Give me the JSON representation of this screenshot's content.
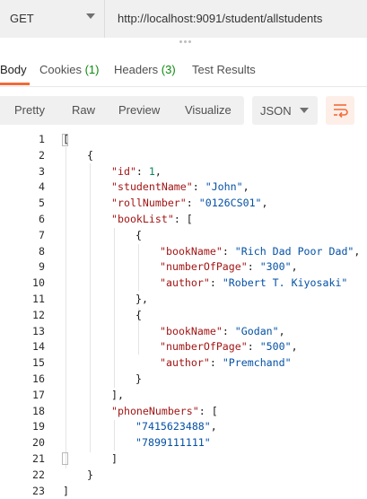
{
  "request": {
    "method": "GET",
    "url": "http://localhost:9091/student/allstudents"
  },
  "response_tabs": [
    {
      "label": "Body",
      "count": ""
    },
    {
      "label": "Cookies",
      "count": "(1)"
    },
    {
      "label": "Headers",
      "count": "(3)"
    },
    {
      "label": "Test Results",
      "count": ""
    }
  ],
  "view_modes": [
    "Pretty",
    "Raw",
    "Preview",
    "Visualize"
  ],
  "format": "JSON",
  "icons": {
    "method_dropdown": "chevron-down-icon",
    "format_dropdown": "chevron-down-icon",
    "wrap": "wrap-lines-icon"
  },
  "colors": {
    "accent": "#f26b3a",
    "count": "#0e8a0e",
    "json_key": "#a31515",
    "json_string": "#0451a5",
    "json_number": "#098658"
  },
  "code_lines": [
    {
      "n": "1",
      "indent": 0,
      "parts": [
        {
          "t": "[",
          "c": "p"
        }
      ]
    },
    {
      "n": "2",
      "indent": 1,
      "parts": [
        {
          "t": "{",
          "c": "p"
        }
      ]
    },
    {
      "n": "3",
      "indent": 2,
      "parts": [
        {
          "t": "\"id\"",
          "c": "k"
        },
        {
          "t": ": ",
          "c": "p"
        },
        {
          "t": "1",
          "c": "n"
        },
        {
          "t": ",",
          "c": "p"
        }
      ]
    },
    {
      "n": "4",
      "indent": 2,
      "parts": [
        {
          "t": "\"studentName\"",
          "c": "k"
        },
        {
          "t": ": ",
          "c": "p"
        },
        {
          "t": "\"John\"",
          "c": "s"
        },
        {
          "t": ",",
          "c": "p"
        }
      ]
    },
    {
      "n": "5",
      "indent": 2,
      "parts": [
        {
          "t": "\"rollNumber\"",
          "c": "k"
        },
        {
          "t": ": ",
          "c": "p"
        },
        {
          "t": "\"0126CS01\"",
          "c": "s"
        },
        {
          "t": ",",
          "c": "p"
        }
      ]
    },
    {
      "n": "6",
      "indent": 2,
      "parts": [
        {
          "t": "\"bookList\"",
          "c": "k"
        },
        {
          "t": ": [",
          "c": "p"
        }
      ]
    },
    {
      "n": "7",
      "indent": 3,
      "parts": [
        {
          "t": "{",
          "c": "p"
        }
      ]
    },
    {
      "n": "8",
      "indent": 4,
      "parts": [
        {
          "t": "\"bookName\"",
          "c": "k"
        },
        {
          "t": ": ",
          "c": "p"
        },
        {
          "t": "\"Rich Dad Poor Dad\"",
          "c": "s"
        },
        {
          "t": ",",
          "c": "p"
        }
      ]
    },
    {
      "n": "9",
      "indent": 4,
      "parts": [
        {
          "t": "\"numberOfPage\"",
          "c": "k"
        },
        {
          "t": ": ",
          "c": "p"
        },
        {
          "t": "\"300\"",
          "c": "s"
        },
        {
          "t": ",",
          "c": "p"
        }
      ]
    },
    {
      "n": "10",
      "indent": 4,
      "parts": [
        {
          "t": "\"author\"",
          "c": "k"
        },
        {
          "t": ": ",
          "c": "p"
        },
        {
          "t": "\"Robert T. Kiyosaki\"",
          "c": "s"
        }
      ]
    },
    {
      "n": "11",
      "indent": 3,
      "parts": [
        {
          "t": "},",
          "c": "p"
        }
      ]
    },
    {
      "n": "12",
      "indent": 3,
      "parts": [
        {
          "t": "{",
          "c": "p"
        }
      ]
    },
    {
      "n": "13",
      "indent": 4,
      "parts": [
        {
          "t": "\"bookName\"",
          "c": "k"
        },
        {
          "t": ": ",
          "c": "p"
        },
        {
          "t": "\"Godan\"",
          "c": "s"
        },
        {
          "t": ",",
          "c": "p"
        }
      ]
    },
    {
      "n": "14",
      "indent": 4,
      "parts": [
        {
          "t": "\"numberOfPage\"",
          "c": "k"
        },
        {
          "t": ": ",
          "c": "p"
        },
        {
          "t": "\"500\"",
          "c": "s"
        },
        {
          "t": ",",
          "c": "p"
        }
      ]
    },
    {
      "n": "15",
      "indent": 4,
      "parts": [
        {
          "t": "\"author\"",
          "c": "k"
        },
        {
          "t": ": ",
          "c": "p"
        },
        {
          "t": "\"Premchand\"",
          "c": "s"
        }
      ]
    },
    {
      "n": "16",
      "indent": 3,
      "parts": [
        {
          "t": "}",
          "c": "p"
        }
      ]
    },
    {
      "n": "17",
      "indent": 2,
      "parts": [
        {
          "t": "],",
          "c": "p"
        }
      ]
    },
    {
      "n": "18",
      "indent": 2,
      "parts": [
        {
          "t": "\"phoneNumbers\"",
          "c": "k"
        },
        {
          "t": ": [",
          "c": "p"
        }
      ]
    },
    {
      "n": "19",
      "indent": 3,
      "parts": [
        {
          "t": "\"7415623488\"",
          "c": "s"
        },
        {
          "t": ",",
          "c": "p"
        }
      ]
    },
    {
      "n": "20",
      "indent": 3,
      "parts": [
        {
          "t": "\"7899111111\"",
          "c": "s"
        }
      ]
    },
    {
      "n": "21",
      "indent": 2,
      "parts": [
        {
          "t": "]",
          "c": "p"
        }
      ]
    },
    {
      "n": "22",
      "indent": 1,
      "parts": [
        {
          "t": "}",
          "c": "p"
        }
      ]
    },
    {
      "n": "23",
      "indent": 0,
      "parts": [
        {
          "t": "]",
          "c": "p"
        }
      ]
    }
  ]
}
